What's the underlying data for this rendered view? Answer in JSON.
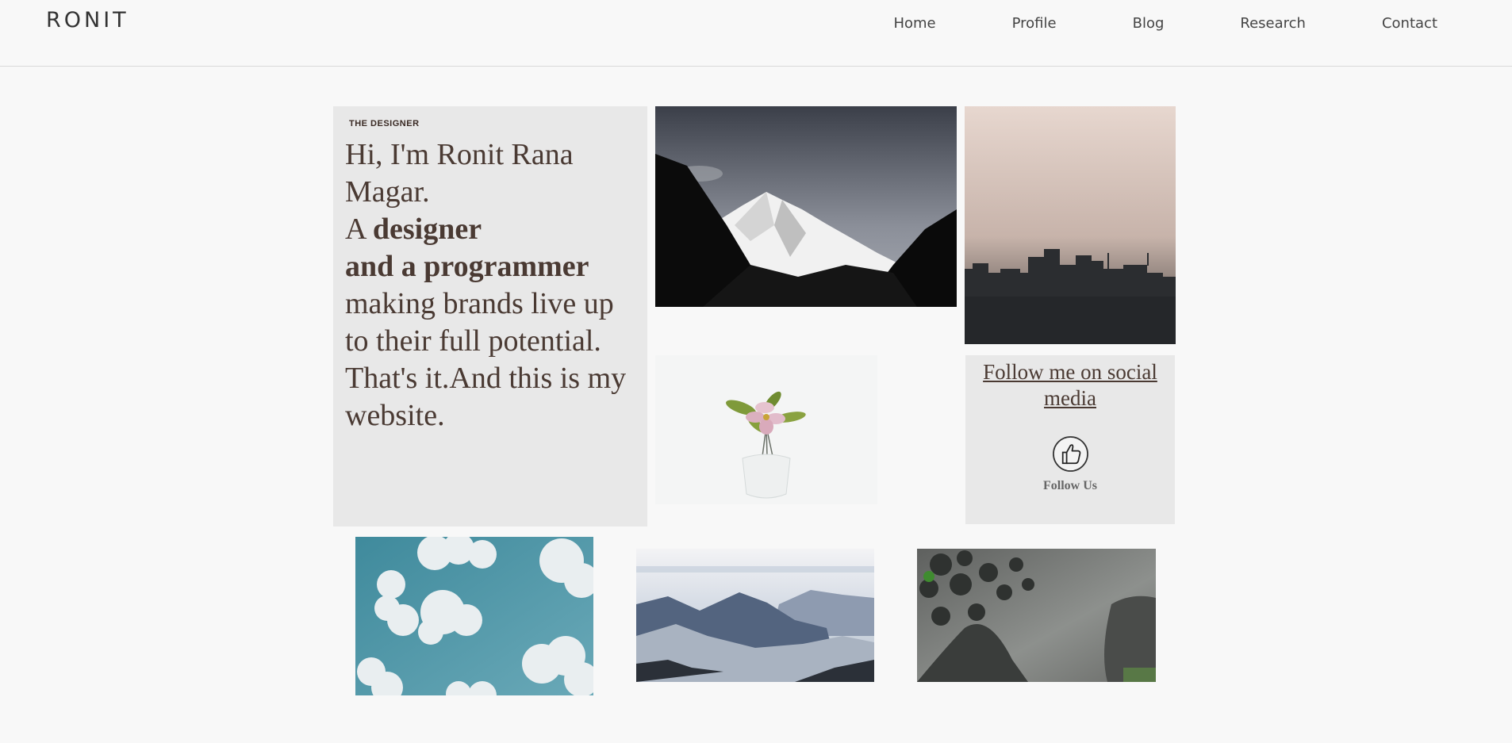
{
  "header": {
    "logo": "RONIT",
    "nav": [
      "Home",
      "Profile",
      "Blog",
      "Research",
      "Contact"
    ]
  },
  "intro": {
    "eyebrow": "THE DESIGNER",
    "line1": "Hi, I'm Ronit Rana Magar.",
    "line2_prefix": "A ",
    "line2_bold": "designer",
    "line3_bold": "and a programmer",
    "line4": "making brands live up",
    "line5": "to their full potential.",
    "line6": "That's it.And this is my website."
  },
  "social": {
    "title": "Follow me on social media",
    "follow_label": "Follow Us",
    "icon": "thumbs-up-icon"
  },
  "photos": {
    "mountain_snow": "snowy-mountain-photo",
    "skyline": "city-skyline-photo",
    "flower": "flower-vase-photo",
    "clouds": "clouds-sky-photo",
    "misty_mountains": "misty-mountains-photo",
    "plant_shadow": "plant-shadow-photo"
  }
}
